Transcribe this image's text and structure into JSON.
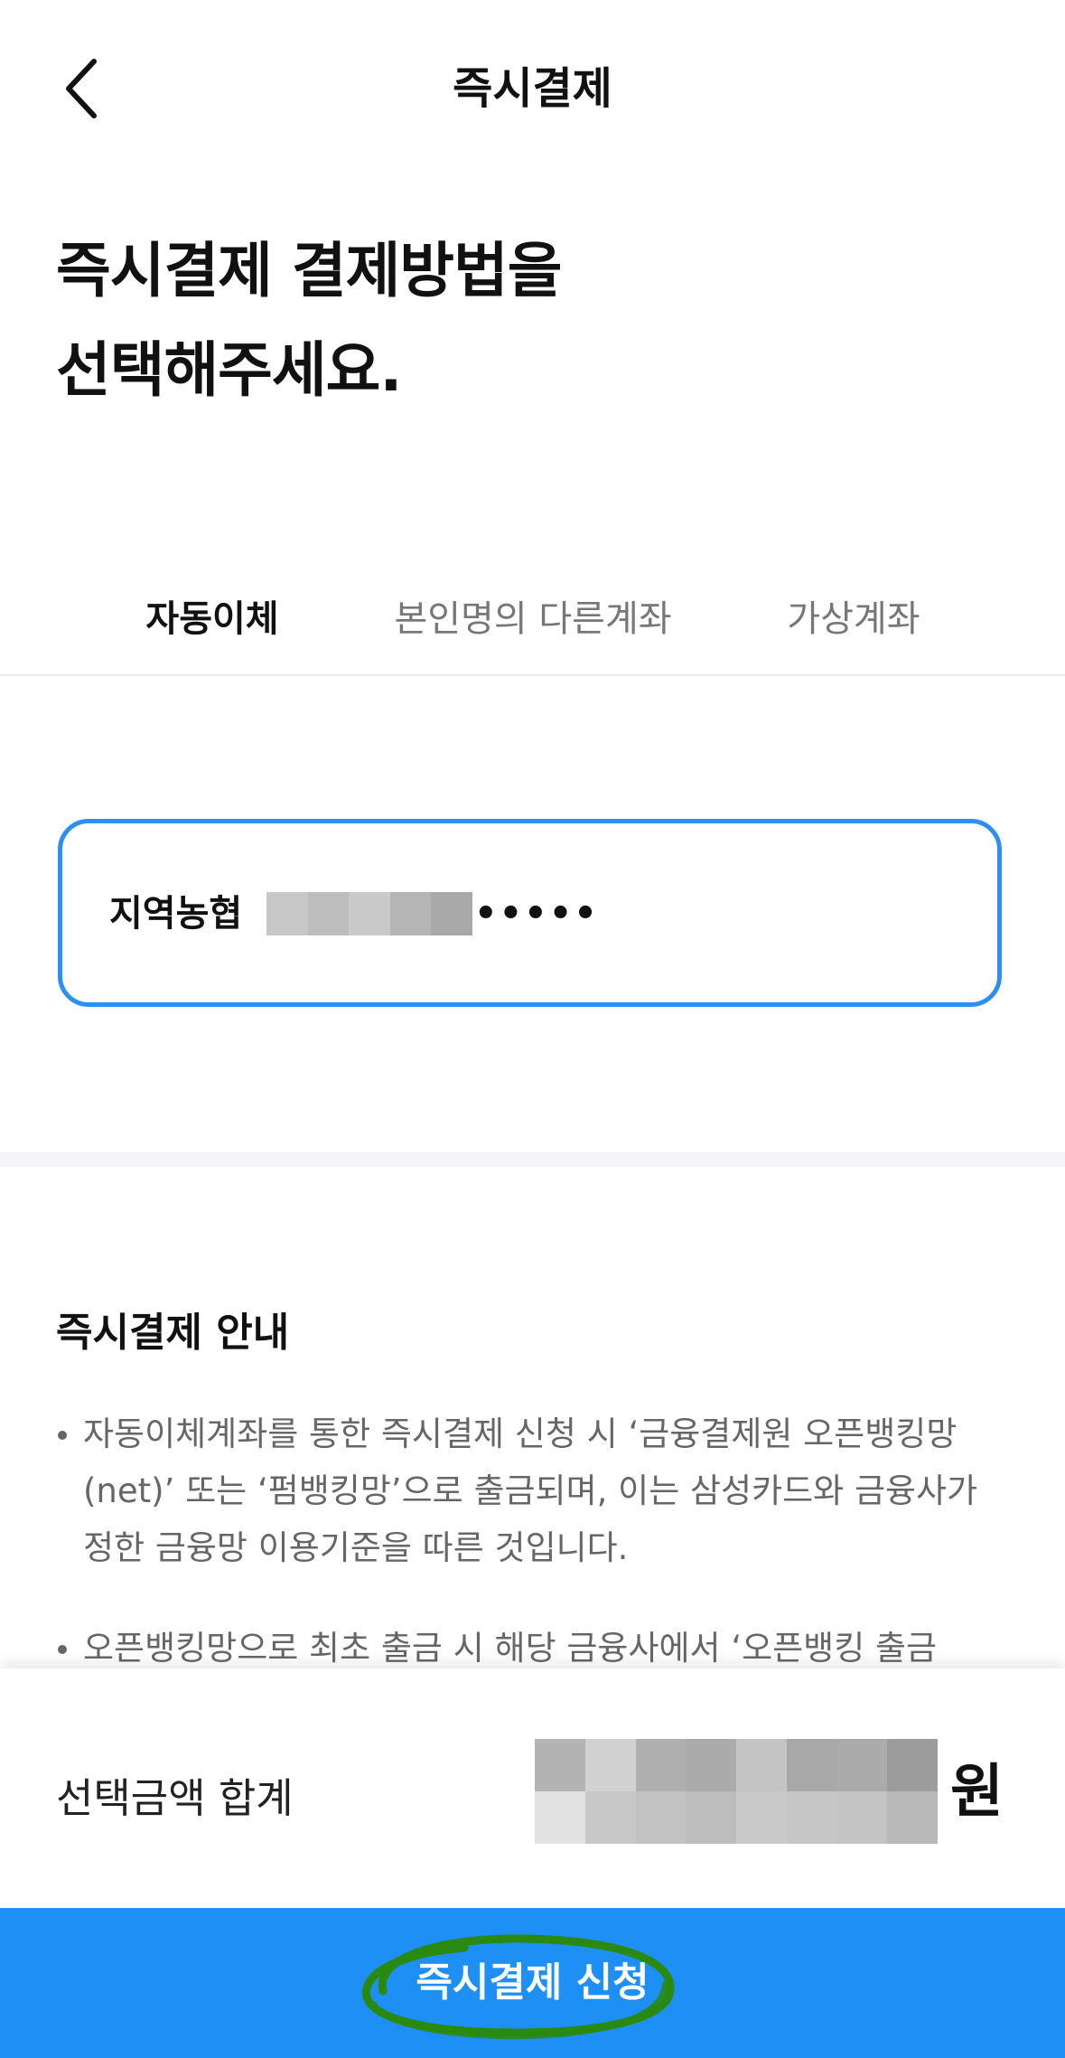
{
  "header": {
    "title": "즉시결제"
  },
  "headline": {
    "line1": "즉시결제 결제방법을",
    "line2": "선택해주세요."
  },
  "tabs": [
    {
      "label": "자동이체",
      "active": true
    },
    {
      "label": "본인명의 다른계좌",
      "active": false
    },
    {
      "label": "가상계좌",
      "active": false
    }
  ],
  "account": {
    "bank": "지역농협",
    "number_suffix": "•••••"
  },
  "guide": {
    "title": "즉시결제 안내",
    "items": [
      "자동이체계좌를 통한 즉시결제 신청 시 ‘금융결제원 오픈뱅킹망(net)’ 또는 ‘펌뱅킹망’으로 출금되며, 이는 삼성카드와 금융사가 정한 금융망 이용기준을 따른 것입니다.",
      "오픈뱅킹망으로 최초 출금 시 해당 금융사에서 ‘오픈뱅킹 출금"
    ]
  },
  "summary": {
    "label": "선택금액 합계",
    "currency": "원"
  },
  "cta": {
    "label": "즉시결제 신청"
  },
  "colors": {
    "accent": "#1e8ff5",
    "card_border": "#2d8ff0",
    "highlight_marker": "#2a8a10"
  },
  "icons": {
    "back": "chevron-left-icon"
  }
}
